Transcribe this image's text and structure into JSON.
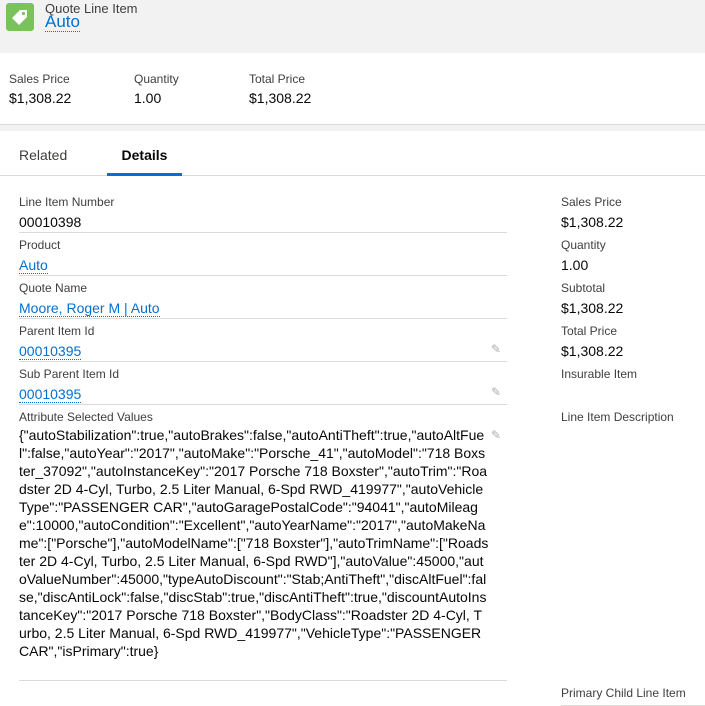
{
  "header": {
    "object_type": "Quote Line Item",
    "record_name": "Auto",
    "icon": "price-tag-icon",
    "icon_color": "#7ac35a"
  },
  "highlights": [
    {
      "label": "Sales Price",
      "value": "$1,308.22"
    },
    {
      "label": "Quantity",
      "value": "1.00"
    },
    {
      "label": "Total Price",
      "value": "$1,308.22"
    }
  ],
  "tabs": {
    "related": "Related",
    "details": "Details",
    "active": "Details"
  },
  "left_fields": {
    "line_item_number": {
      "label": "Line Item Number",
      "value": "00010398"
    },
    "product": {
      "label": "Product",
      "value": "Auto"
    },
    "quote_name": {
      "label": "Quote Name",
      "value": "Moore, Roger M | Auto"
    },
    "parent_item_id": {
      "label": "Parent Item Id",
      "value": "00010395"
    },
    "sub_parent_item_id": {
      "label": "Sub Parent Item Id",
      "value": "00010395"
    },
    "attribute_selected_values": {
      "label": "Attribute Selected Values",
      "value": "{\"autoStabilization\":true,\"autoBrakes\":false,\"autoAntiTheft\":true,\"autoAltFuel\":false,\"autoYear\":\"2017\",\"autoMake\":\"Porsche_41\",\"autoModel\":\"718 Boxster_37092\",\"autoInstanceKey\":\"2017 Porsche 718 Boxster\",\"autoTrim\":\"Roadster 2D 4-Cyl, Turbo, 2.5 Liter Manual, 6-Spd RWD_419977\",\"autoVehicleType\":\"PASSENGER CAR\",\"autoGaragePostalCode\":\"94041\",\"autoMileage\":10000,\"autoCondition\":\"Excellent\",\"autoYearName\":\"2017\",\"autoMakeName\":[\"Porsche\"],\"autoModelName\":[\"718 Boxster\"],\"autoTrimName\":[\"Roadster 2D 4-Cyl, Turbo, 2.5 Liter Manual, 6-Spd RWD\"],\"autoValue\":45000,\"autoValueNumber\":45000,\"typeAutoDiscount\":\"Stab;AntiTheft\",\"discAltFuel\":false,\"discAntiLock\":false,\"discStab\":true,\"discAntiTheft\":true,\"discountAutoInstanceKey\":\"2017 Porsche 718 Boxster\",\"BodyClass\":\"Roadster 2D 4-Cyl, Turbo, 2.5 Liter Manual, 6-Spd RWD_419977\",\"VehicleType\":\"PASSENGER CAR\",\"isPrimary\":true}"
    }
  },
  "right_fields": {
    "sales_price": {
      "label": "Sales Price",
      "value": "$1,308.22"
    },
    "quantity": {
      "label": "Quantity",
      "value": "1.00"
    },
    "subtotal": {
      "label": "Subtotal",
      "value": "$1,308.22"
    },
    "total_price": {
      "label": "Total Price",
      "value": "$1,308.22"
    },
    "insurable_item": {
      "label": "Insurable Item",
      "value": ""
    },
    "line_item_description": {
      "label": "Line Item Description",
      "value": ""
    },
    "primary_child_line_item": {
      "label": "Primary Child Line Item",
      "value": ""
    }
  },
  "colors": {
    "link": "#0070d2",
    "header_bg": "#f3f2f2",
    "divider": "#dddbda"
  }
}
